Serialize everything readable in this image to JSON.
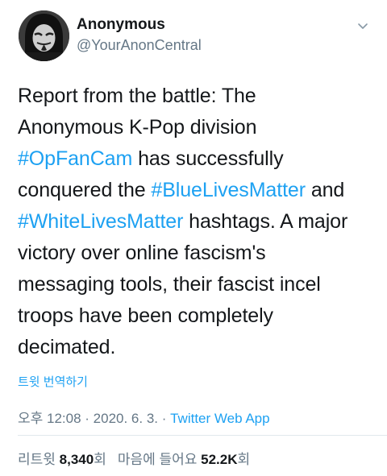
{
  "author": {
    "display_name": "Anonymous",
    "handle": "@YourAnonCentral"
  },
  "tweet": {
    "lines": [
      [
        {
          "text": "Report from the battle: The",
          "type": "text"
        }
      ],
      [
        {
          "text": "Anonymous K-Pop division",
          "type": "text"
        }
      ],
      [
        {
          "text": "#OpFanCam",
          "type": "hashtag"
        },
        {
          "text": " has successfully",
          "type": "text"
        }
      ],
      [
        {
          "text": "conquered the ",
          "type": "text"
        },
        {
          "text": "#BlueLivesMatter",
          "type": "hashtag"
        },
        {
          "text": " and",
          "type": "text"
        }
      ],
      [
        {
          "text": "#WhiteLivesMatter",
          "type": "hashtag"
        },
        {
          "text": " hashtags. A major",
          "type": "text"
        }
      ],
      [
        {
          "text": "victory over online fascism's",
          "type": "text"
        }
      ],
      [
        {
          "text": "messaging tools, their fascist incel",
          "type": "text"
        }
      ],
      [
        {
          "text": "troops have been completely",
          "type": "text"
        }
      ],
      [
        {
          "text": "decimated.",
          "type": "text"
        }
      ]
    ],
    "translate_label": "트윗 번역하기"
  },
  "meta": {
    "time": "오후 12:08",
    "separator": " · ",
    "date": "2020. 6. 3.",
    "source": "Twitter Web App"
  },
  "stats": {
    "retweets_label": "리트윗 ",
    "retweets_count": "8,340",
    "retweets_suffix": "회",
    "likes_label": "마음에 들어요 ",
    "likes_count": "52.2K",
    "likes_suffix": "회"
  },
  "colors": {
    "link": "#1da1f2",
    "text": "#14171a",
    "secondary": "#657786",
    "border": "#e1e8ed"
  },
  "icons": {
    "menu": "chevron-down-icon",
    "avatar": "hooded-mask-avatar"
  }
}
